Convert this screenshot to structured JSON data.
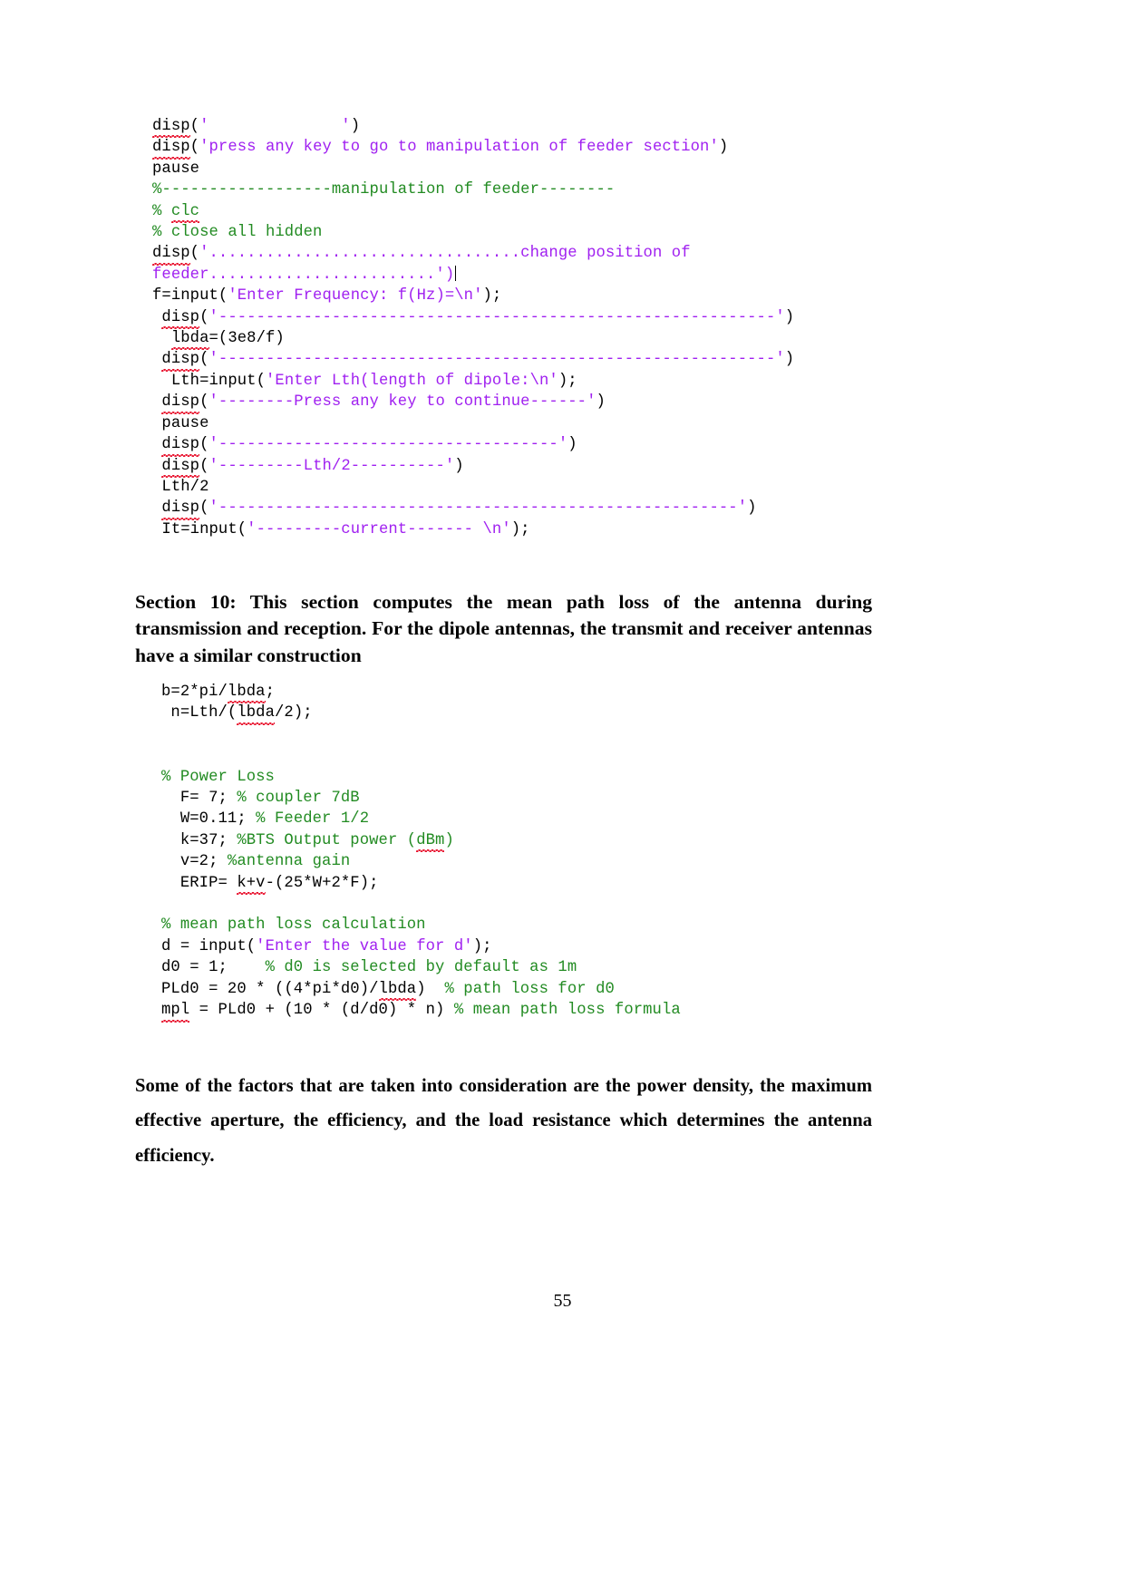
{
  "document": {
    "page_number": "55",
    "code_block_1": {
      "lines": [
        [
          {
            "t": "disp",
            "c": "plain",
            "spell": true
          },
          {
            "t": "(",
            "c": "plain"
          },
          {
            "t": "'              '",
            "c": "string"
          },
          {
            "t": ")",
            "c": "plain"
          }
        ],
        [
          {
            "t": "disp",
            "c": "plain",
            "spell": true
          },
          {
            "t": "(",
            "c": "plain"
          },
          {
            "t": "'press any key to go to manipulation of feeder section'",
            "c": "string"
          },
          {
            "t": ")",
            "c": "plain"
          }
        ],
        [
          {
            "t": "pause",
            "c": "plain"
          }
        ],
        [
          {
            "t": "%------------------manipulation of feeder--------",
            "c": "comment"
          }
        ],
        [
          {
            "t": "% ",
            "c": "comment"
          },
          {
            "t": "clc",
            "c": "comment",
            "spell": true
          }
        ],
        [
          {
            "t": "% close all hidden",
            "c": "comment"
          }
        ],
        [
          {
            "t": "disp",
            "c": "plain",
            "spell": true
          },
          {
            "t": "(",
            "c": "plain"
          },
          {
            "t": "'.................................change position of",
            "c": "string"
          }
        ],
        [
          {
            "t": "feeder........................')",
            "c": "string"
          },
          {
            "t": "|",
            "c": "caret"
          }
        ],
        [
          {
            "t": "f=input",
            "c": "plain"
          },
          {
            "t": "(",
            "c": "plain"
          },
          {
            "t": "'Enter Frequency: f(Hz)=\\n'",
            "c": "string"
          },
          {
            "t": ");",
            "c": "plain"
          }
        ],
        [
          {
            "t": " ",
            "c": "plain"
          },
          {
            "t": "disp",
            "c": "plain",
            "spell": true
          },
          {
            "t": "(",
            "c": "plain"
          },
          {
            "t": "'-----------------------------------------------------------'",
            "c": "string"
          },
          {
            "t": ")",
            "c": "plain"
          }
        ],
        [
          {
            "t": "  ",
            "c": "plain"
          },
          {
            "t": "lbda",
            "c": "plain",
            "spell": true
          },
          {
            "t": "=(3e8/f)",
            "c": "plain"
          }
        ],
        [
          {
            "t": " ",
            "c": "plain"
          },
          {
            "t": "disp",
            "c": "plain",
            "spell": true
          },
          {
            "t": "(",
            "c": "plain"
          },
          {
            "t": "'-----------------------------------------------------------'",
            "c": "string"
          },
          {
            "t": ")",
            "c": "plain"
          }
        ],
        [
          {
            "t": "  Lth=input",
            "c": "plain"
          },
          {
            "t": "(",
            "c": "plain"
          },
          {
            "t": "'Enter Lth(length of dipole:\\n'",
            "c": "string"
          },
          {
            "t": ");",
            "c": "plain"
          }
        ],
        [
          {
            "t": " ",
            "c": "plain"
          },
          {
            "t": "disp",
            "c": "plain",
            "spell": true
          },
          {
            "t": "(",
            "c": "plain"
          },
          {
            "t": "'--------Press any key to continue------'",
            "c": "string"
          },
          {
            "t": ")",
            "c": "plain"
          }
        ],
        [
          {
            "t": " pause",
            "c": "plain"
          }
        ],
        [
          {
            "t": " ",
            "c": "plain"
          },
          {
            "t": "disp",
            "c": "plain",
            "spell": true
          },
          {
            "t": "(",
            "c": "plain"
          },
          {
            "t": "'------------------------------------'",
            "c": "string"
          },
          {
            "t": ")",
            "c": "plain"
          }
        ],
        [
          {
            "t": " ",
            "c": "plain"
          },
          {
            "t": "disp",
            "c": "plain",
            "spell": true
          },
          {
            "t": "(",
            "c": "plain"
          },
          {
            "t": "'---------Lth/2----------'",
            "c": "string"
          },
          {
            "t": ")",
            "c": "plain"
          }
        ],
        [
          {
            "t": " Lth/2",
            "c": "plain"
          }
        ],
        [
          {
            "t": " ",
            "c": "plain"
          },
          {
            "t": "disp",
            "c": "plain",
            "spell": true
          },
          {
            "t": "(",
            "c": "plain"
          },
          {
            "t": "'-------------------------------------------------------'",
            "c": "string"
          },
          {
            "t": ")",
            "c": "plain"
          }
        ],
        [
          {
            "t": " It=input",
            "c": "plain"
          },
          {
            "t": "(",
            "c": "plain"
          },
          {
            "t": "'---------current------- \\n'",
            "c": "string"
          },
          {
            "t": ");",
            "c": "plain"
          }
        ]
      ]
    },
    "code_block_2": {
      "lines": [
        [
          {
            "t": "b=2*pi/",
            "c": "plain"
          },
          {
            "t": "lbda",
            "c": "plain",
            "spell": true
          },
          {
            "t": ";",
            "c": "plain"
          }
        ],
        [
          {
            "t": " n=Lth/(",
            "c": "plain"
          },
          {
            "t": "lbda",
            "c": "plain",
            "spell": true
          },
          {
            "t": "/2);",
            "c": "plain"
          }
        ],
        [],
        [],
        [
          {
            "t": "% Power Loss",
            "c": "comment"
          }
        ],
        [
          {
            "t": "  F= 7; ",
            "c": "plain"
          },
          {
            "t": "% coupler 7dB",
            "c": "comment"
          }
        ],
        [
          {
            "t": "  W=0.11; ",
            "c": "plain"
          },
          {
            "t": "% Feeder 1/2",
            "c": "comment"
          }
        ],
        [
          {
            "t": "  k=37; ",
            "c": "plain"
          },
          {
            "t": "%BTS Output power (",
            "c": "comment"
          },
          {
            "t": "dBm",
            "c": "comment",
            "spell": true
          },
          {
            "t": ")",
            "c": "comment"
          }
        ],
        [
          {
            "t": "  v=2; ",
            "c": "plain"
          },
          {
            "t": "%antenna gain",
            "c": "comment"
          }
        ],
        [
          {
            "t": "  ERIP= ",
            "c": "plain"
          },
          {
            "t": "k+v",
            "c": "plain",
            "spell": true
          },
          {
            "t": "-(25*W+2*F);",
            "c": "plain"
          }
        ],
        [],
        [
          {
            "t": "% mean path loss calculation",
            "c": "comment"
          }
        ],
        [
          {
            "t": "d = input",
            "c": "plain"
          },
          {
            "t": "(",
            "c": "plain"
          },
          {
            "t": "'Enter the value for d'",
            "c": "string"
          },
          {
            "t": ");",
            "c": "plain"
          }
        ],
        [
          {
            "t": "d0 = 1;    ",
            "c": "plain"
          },
          {
            "t": "% d0 is selected by default as 1m",
            "c": "comment"
          }
        ],
        [
          {
            "t": "PLd0 = 20 * ((4*pi*d0)/",
            "c": "plain"
          },
          {
            "t": "lbda",
            "c": "plain",
            "spell": true
          },
          {
            "t": ")  ",
            "c": "plain"
          },
          {
            "t": "% path loss for d0",
            "c": "comment"
          }
        ],
        [
          {
            "t": "mpl",
            "c": "plain",
            "spell": true
          },
          {
            "t": " = PLd0 + (10 * (d/d0) * n) ",
            "c": "plain"
          },
          {
            "t": "% mean path loss formula",
            "c": "comment"
          }
        ]
      ]
    },
    "paragraphs": {
      "section_10": "Section 10: This section computes the mean path loss of the antenna during transmission and reception. For the dipole antennas, the transmit and receiver antennas have a similar construction",
      "closing": "Some of the factors that are taken into consideration are the power density, the maximum effective aperture, the efficiency, and the load resistance which determines the antenna efficiency."
    },
    "colors": {
      "string": "#a020f0",
      "comment": "#228b22",
      "plain": "#000000",
      "spellcheck_underline": "#e8112d"
    }
  }
}
